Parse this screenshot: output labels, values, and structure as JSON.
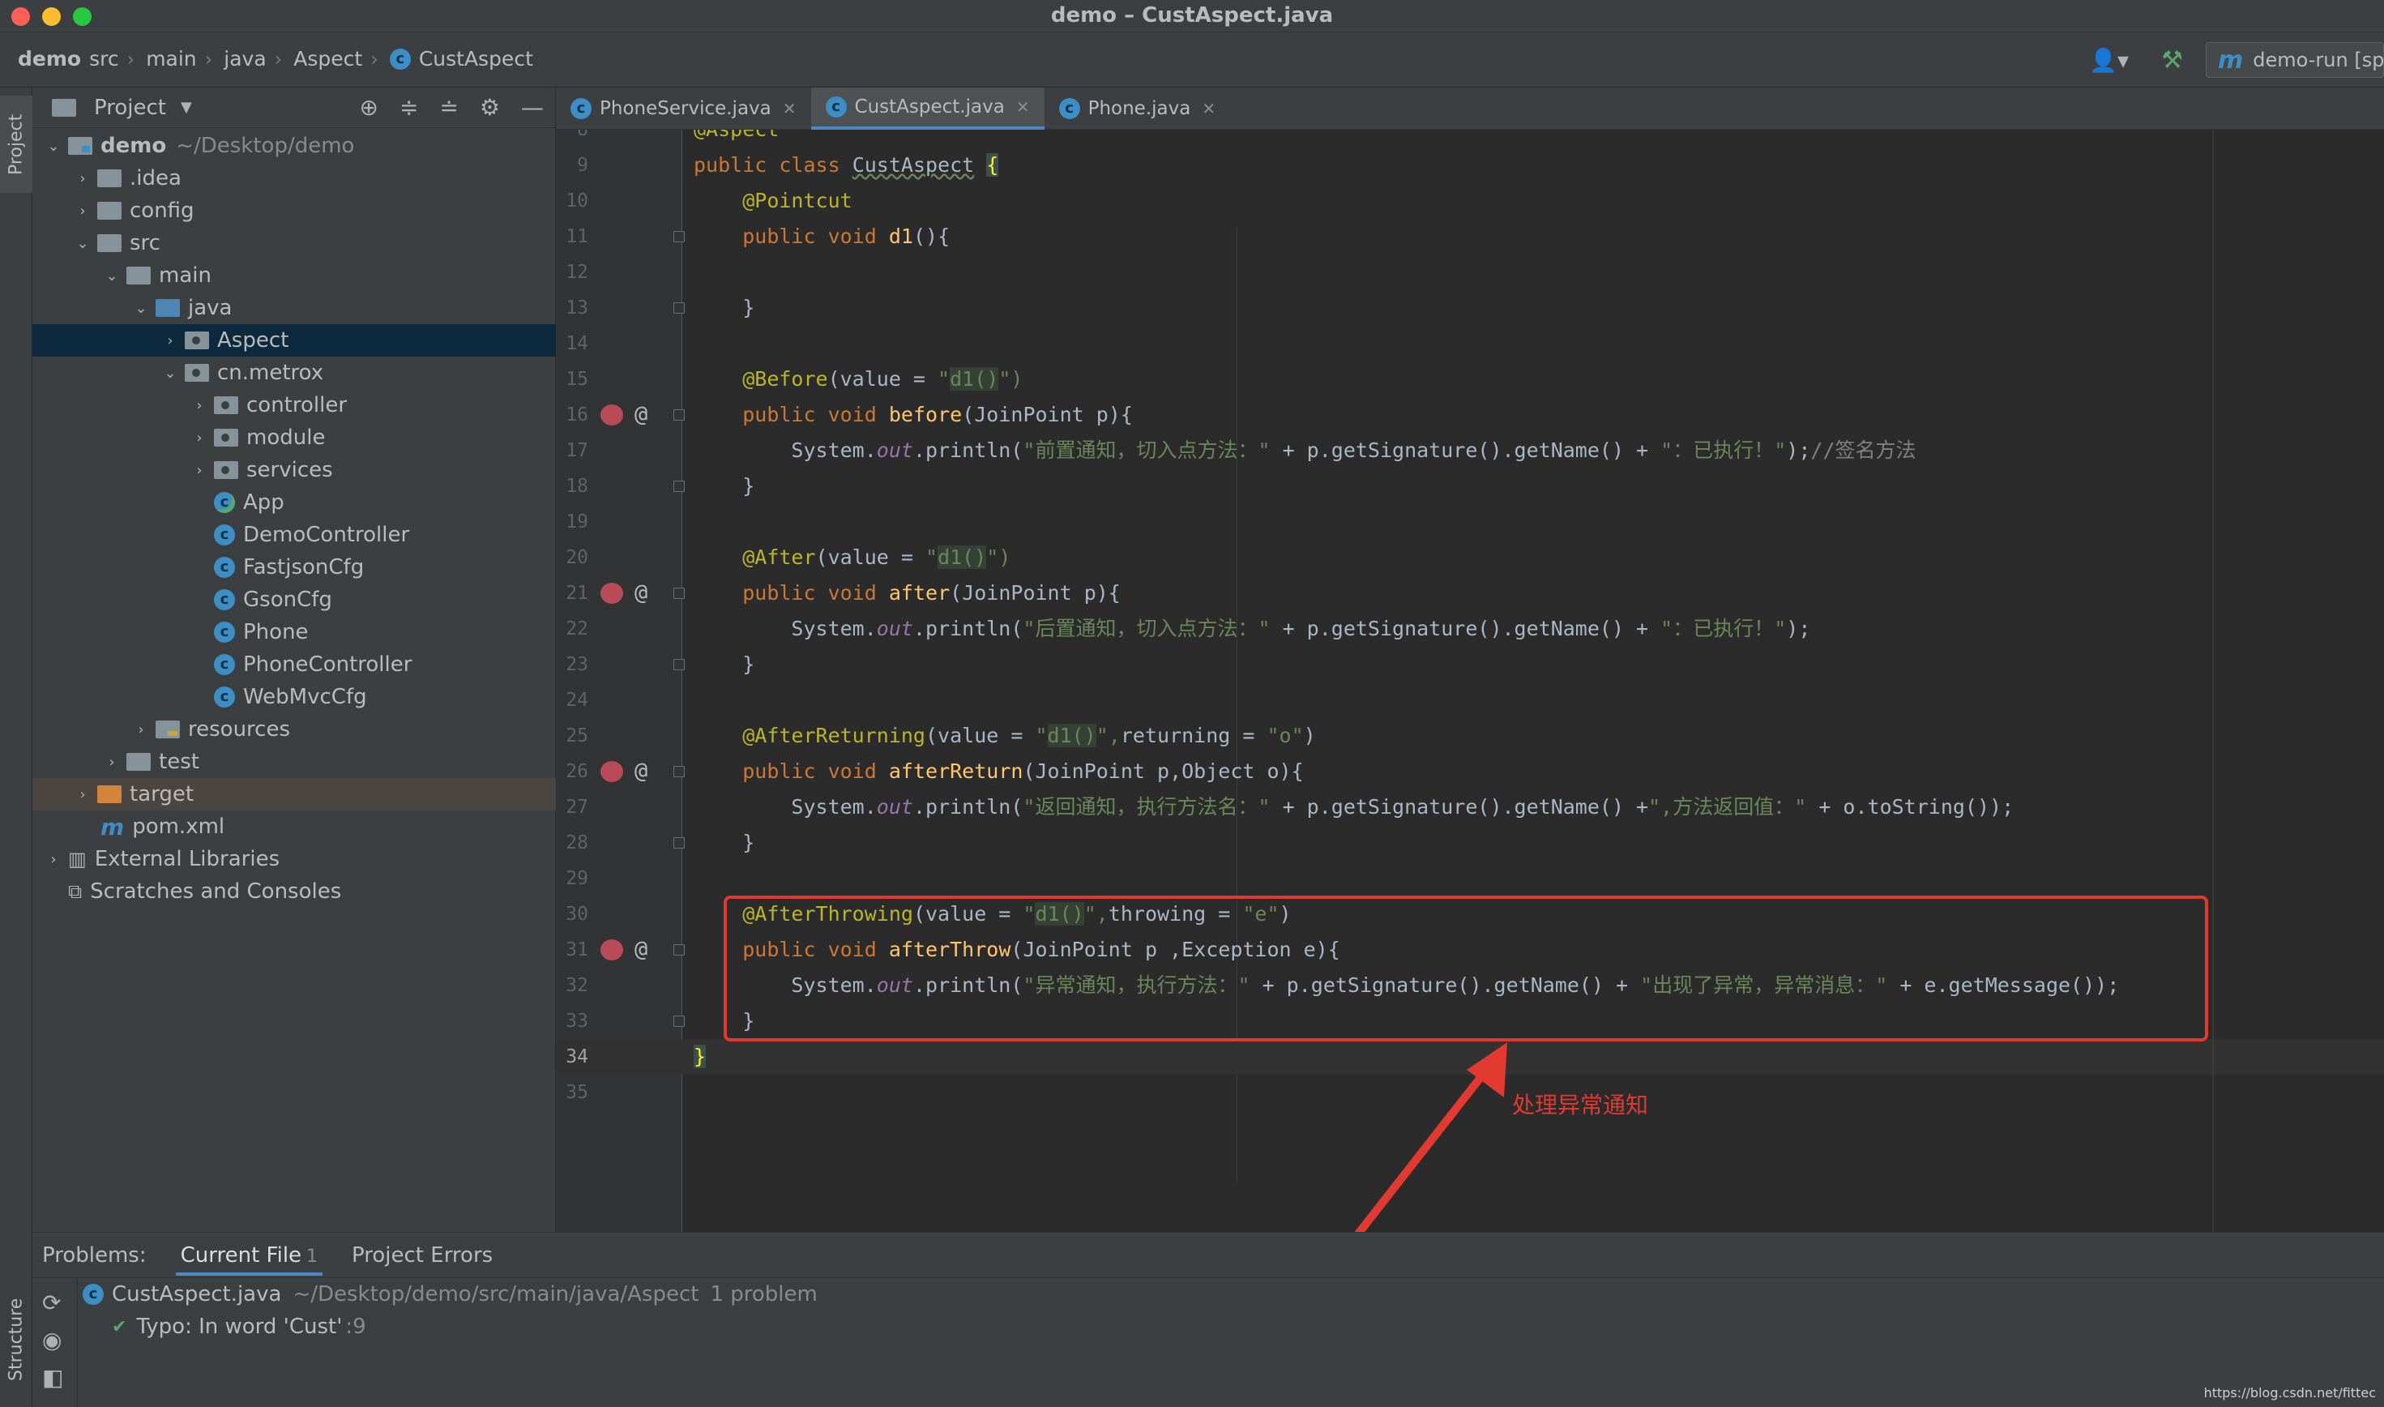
{
  "window": {
    "title": "demo – CustAspect.java"
  },
  "breadcrumbs": [
    "demo",
    "src",
    "main",
    "java",
    "Aspect",
    "CustAspect"
  ],
  "navbar": {
    "run_config": "demo-run [sprir"
  },
  "left_strip": {
    "project": "Project",
    "structure": "Structure"
  },
  "project_panel": {
    "title": "Project",
    "tree": [
      {
        "label": "demo",
        "path": "~/Desktop/demo"
      },
      {
        "label": ".idea"
      },
      {
        "label": "config"
      },
      {
        "label": "src"
      },
      {
        "label": "main"
      },
      {
        "label": "java"
      },
      {
        "label": "Aspect"
      },
      {
        "label": "cn.metrox"
      },
      {
        "label": "controller"
      },
      {
        "label": "module"
      },
      {
        "label": "services"
      },
      {
        "label": "App"
      },
      {
        "label": "DemoController"
      },
      {
        "label": "FastjsonCfg"
      },
      {
        "label": "GsonCfg"
      },
      {
        "label": "Phone"
      },
      {
        "label": "PhoneController"
      },
      {
        "label": "WebMvcCfg"
      },
      {
        "label": "resources"
      },
      {
        "label": "test"
      },
      {
        "label": "target"
      },
      {
        "label": "pom.xml"
      },
      {
        "label": "External Libraries"
      },
      {
        "label": "Scratches and Consoles"
      }
    ]
  },
  "editor_tabs": [
    {
      "label": "PhoneService.java"
    },
    {
      "label": "CustAspect.java"
    },
    {
      "label": "Phone.java"
    }
  ],
  "code": {
    "line_numbers": [
      "8",
      "9",
      "10",
      "11",
      "12",
      "13",
      "14",
      "15",
      "16",
      "17",
      "18",
      "19",
      "20",
      "21",
      "22",
      "23",
      "24",
      "25",
      "26",
      "27",
      "28",
      "29",
      "30",
      "31",
      "32",
      "33",
      "34",
      "35"
    ],
    "t": {
      "aspect": "@Aspect",
      "public": "public",
      "class": "class",
      "void": "void",
      "object_type": "Object",
      "class_name": "CustAspect",
      "open_brace": "{",
      "close_brace": "}",
      "pointcut": "@Pointcut",
      "d1": "d1",
      "d1_sig": "(){",
      "before_ann": "@Before",
      "after_ann": "@After",
      "afterreturning_ann": "@AfterReturning",
      "afterthrowing_ann": "@AfterThrowing",
      "value_eq": "(value = ",
      "q_open": "\"",
      "d1_call": "d1()",
      "q_close_paren": "\")",
      "q_comma": "\",",
      "returning_eq": "returning = ",
      "throwing_eq": "throwing = ",
      "str_o": "\"o\"",
      "str_e": "\"e\"",
      "paren_close": ")",
      "before_fn": "before",
      "after_fn": "after",
      "afterreturn_fn": "afterReturn",
      "afterthrow_fn": "afterThrow",
      "param_jp": "(JoinPoint p){",
      "param_jp_obj_a": "(JoinPoint p,",
      "param_jp_obj_b": " o){",
      "param_jp_ex": "(JoinPoint p ,Exception e){",
      "system_dot": "System.",
      "out": "out",
      "println_open": ".println(",
      "plus_sig": " + p.getSignature().getName() +",
      "plus_sig_nospace": " + p.getSignature().getName() +",
      "plus_o_tostring": " + o.toString());",
      "plus_e_msg": " + e.getMessage());",
      "end_stmt": ");",
      "semicolon": ";",
      "comment": "//签名方法",
      "s_before": "\"前置通知，切入点方法：\"",
      "s_after": "\"后置通知，切入点方法：\"",
      "s_exec": "\"：已执行！\"",
      "s_return": "\"返回通知，执行方法名：\"",
      "s_return_val": "\",方法返回值：\"",
      "s_throw": "\"异常通知，执行方法：\"",
      "s_throw_msg": "\"出现了异常，异常消息：\""
    }
  },
  "annotation": {
    "label": "处理异常通知",
    "color": "#e23a31"
  },
  "problems": {
    "label": "Problems:",
    "tabs": [
      {
        "label": "Current File",
        "count": "1"
      },
      {
        "label": "Project Errors"
      }
    ],
    "file": "CustAspect.java",
    "file_path": "~/Desktop/demo/src/main/java/Aspect",
    "file_count": "1 problem",
    "item": "Typo: In word 'Cust'",
    "item_line": ":9"
  },
  "watermark": "https://blog.csdn.net/fittec",
  "colors": {
    "keyword": "#cc7832",
    "annotation": "#bbb529",
    "string": "#6a8759",
    "function": "#ffc66d",
    "selection": "#0d293e",
    "accent": "#4a88c7"
  }
}
